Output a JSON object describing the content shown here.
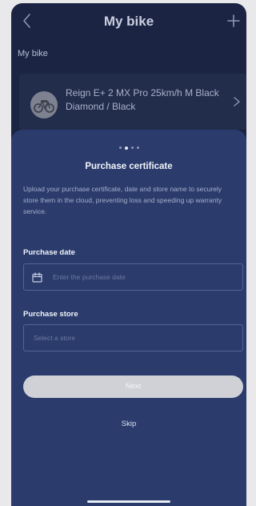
{
  "header": {
    "title": "My bike"
  },
  "bike_section": {
    "label": "My bike",
    "bike_name": "Reign E+ 2 MX Pro 25km/h M Black Diamond / Black"
  },
  "sheet": {
    "pager": {
      "count": 4,
      "active_index": 1
    },
    "title": "Purchase certificate",
    "description": "Upload your purchase certificate, date and store name to securely store them in the cloud, preventing loss and speeding up warranty service.",
    "purchase_date": {
      "label": "Purchase date",
      "placeholder": "Enter the purchase date"
    },
    "purchase_store": {
      "label": "Purchase store",
      "placeholder": "Select a store"
    },
    "next_label": "Next",
    "skip_label": "Skip"
  },
  "colors": {
    "background": "#1b2442",
    "sheet": "#2a3b6c",
    "field_border": "#56649a",
    "button_disabled": "#cfd1d6"
  },
  "icons": {
    "back": "chevron-left-icon",
    "add": "plus-icon",
    "bike": "bike-thumbnail",
    "chevron": "chevron-right-icon",
    "calendar": "calendar-icon"
  }
}
